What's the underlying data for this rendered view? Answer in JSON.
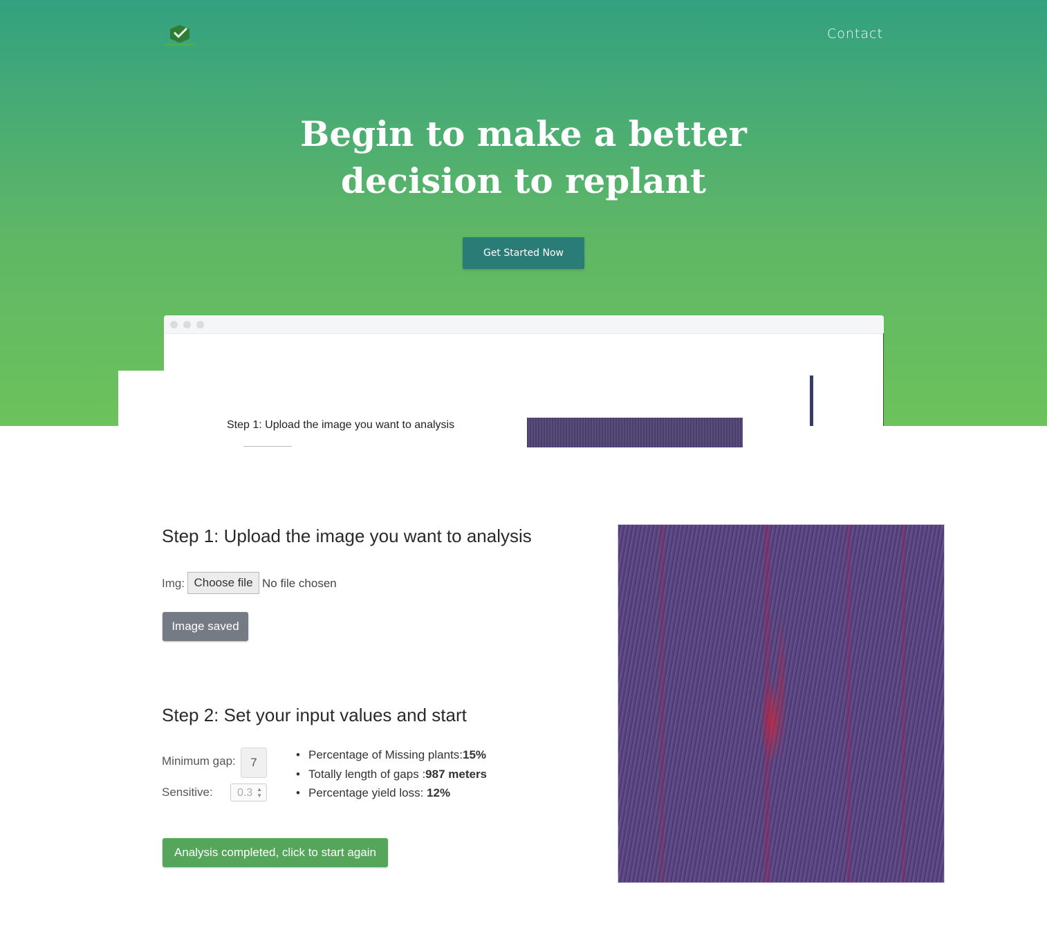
{
  "nav": {
    "contact_label": "Contact",
    "logo_icon": "leaf-check-logo"
  },
  "hero": {
    "headline_line1": "Begin to make a better",
    "headline_line2": "decision to replant",
    "cta_label": "Get Started Now"
  },
  "preview": {
    "step1_title": "Step 1: Upload the image you want to analysis"
  },
  "step1": {
    "title": "Step 1: Upload the image you want to analysis",
    "img_label": "Img:",
    "choose_file_label": "Choose file",
    "no_file_text": "No file chosen",
    "saved_button_label": "Image saved"
  },
  "step2": {
    "title": "Step 2: Set your input values and start",
    "min_gap_label": "Minimum gap:",
    "min_gap_value": "7",
    "sensitive_label": "Sensitive:",
    "sensitive_value": "0.3",
    "results": [
      {
        "label": "Percentage of Missing plants:",
        "value": "15%"
      },
      {
        "label": "Totally length of gaps :",
        "value": "987 meters"
      },
      {
        "label": "Percentage yield loss: ",
        "value": "12%"
      }
    ],
    "analysis_button_label": "Analysis completed, click to start again"
  },
  "colors": {
    "hero_top": "#33a180",
    "hero_bottom": "#6cc25b",
    "cta_bg": "#2a7d76",
    "saved_button_bg": "#757b84",
    "analysis_button_bg": "#55a65a"
  }
}
